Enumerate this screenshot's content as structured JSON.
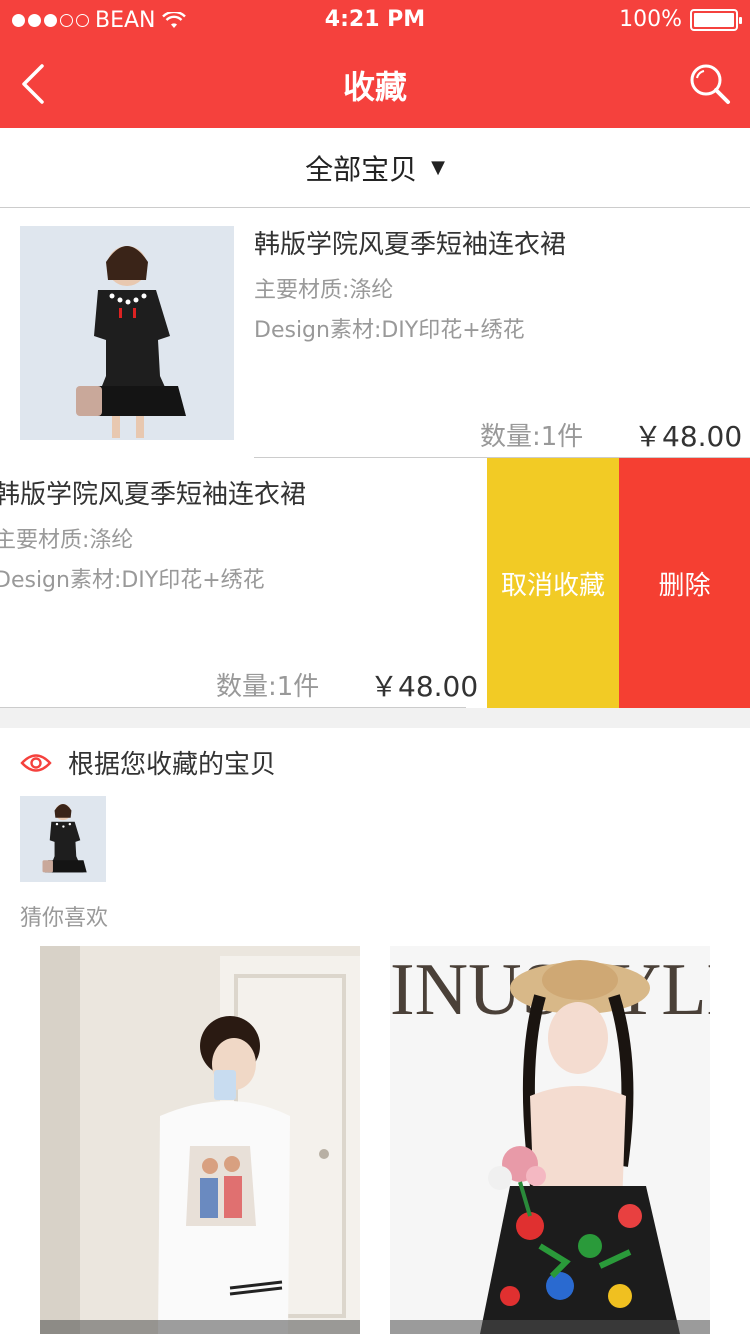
{
  "status_bar": {
    "carrier": "BEAN",
    "time": "4:21 PM",
    "battery": "100%"
  },
  "nav": {
    "title": "收藏"
  },
  "filter": {
    "label": "全部宝贝"
  },
  "favorites": [
    {
      "title": "韩版学院风夏季短袖连衣裙",
      "material": "主要材质:涤纶",
      "design": "Design素材:DIY印花+绣花",
      "quantity": "数量:1件",
      "price": "￥48.00"
    },
    {
      "title": "韩版学院风夏季短袖连衣裙",
      "material": "主要材质:涤纶",
      "design": "Design素材:DIY印花+绣花",
      "quantity": "数量:1件",
      "price": "￥48.00"
    }
  ],
  "swipe_actions": {
    "cancel": "取消收藏",
    "delete": "删除"
  },
  "recommend": {
    "heading": "根据您收藏的宝贝",
    "guess": "猜你喜欢"
  },
  "cards": [
    {
      "brand": ""
    },
    {
      "brand": "INUSTYLE"
    }
  ],
  "colors": {
    "brand_red": "#f5413d",
    "action_yellow": "#f2cb25",
    "action_red": "#f53f32"
  }
}
